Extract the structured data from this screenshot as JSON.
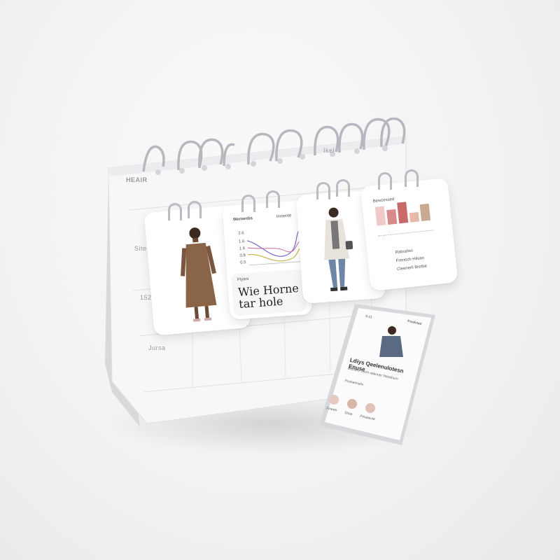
{
  "calendar": {
    "header_label": "HEAIR",
    "header_right": "Ikel",
    "row_labels": [
      "Siteo",
      "1520",
      "Jursa"
    ]
  },
  "cards": [
    {
      "kind": "photo",
      "icon": "person-in-dress-photo",
      "outfit_color": "#8a6447"
    },
    {
      "kind": "chart",
      "title": "Wemenbs",
      "right_label": "Imeente",
      "y_ticks": [
        "2.6",
        "1.6",
        "1.6",
        "0.8",
        "0.5"
      ],
      "caption": "Piyani",
      "big_text": "Wie Horne tar hole"
    },
    {
      "kind": "photo",
      "icon": "person-in-cardigan-photo",
      "outfit_color": "#e8e3da"
    },
    {
      "kind": "bars",
      "title": "Bewcessed",
      "bar_values": [
        0.9,
        0.7,
        1.0,
        0.45,
        0.8
      ],
      "bar_colors": [
        "#f0c9c9",
        "#d98b8b",
        "#c86a6a",
        "#e8b8a8",
        "#c9a990"
      ],
      "list": [
        "Rabrahwi",
        "Frenoch Hilsao",
        "Cleenerli Bretbe"
      ]
    }
  ],
  "phone": {
    "status_left": "9:41",
    "header": "Fooknas",
    "headline": "Ldiys Qeelenulotesn Enuse",
    "subline": "Elohent Tesrh ntlenner Ntsrebum",
    "section_label": "Pnobesnelis",
    "items": [
      "Fineetr",
      "Stiae",
      "Pinaseule"
    ]
  }
}
